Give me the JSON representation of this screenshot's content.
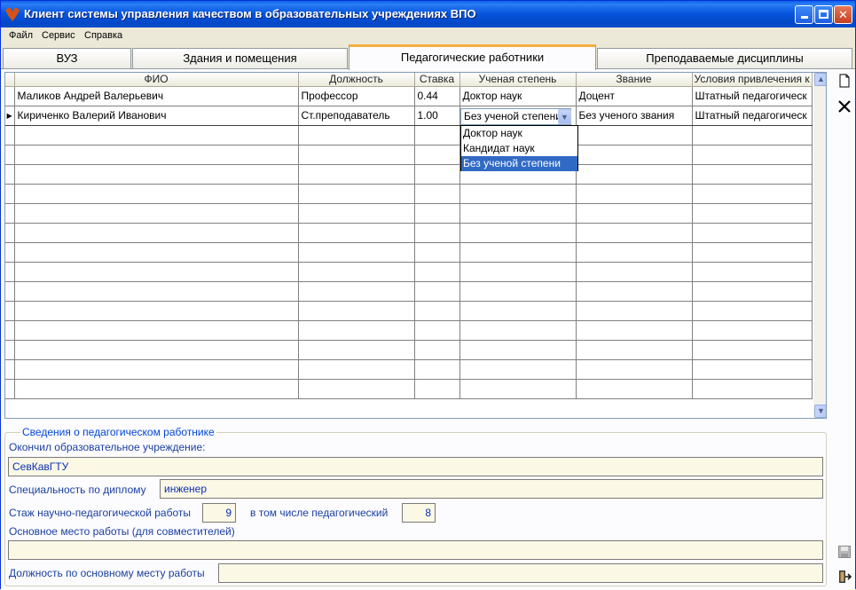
{
  "window": {
    "title": "Клиент системы управления качеством в образовательных учреждениях ВПО"
  },
  "menu": [
    "Файл",
    "Сервис",
    "Справка"
  ],
  "tabs": [
    "ВУЗ",
    "Здания и помещения",
    "Педагогические работники",
    "Преподаваемые дисциплины"
  ],
  "active_tab": "Педагогические работники",
  "grid": {
    "columns": [
      "ФИО",
      "Должность",
      "Ставка",
      "Ученая степень",
      "Звание",
      "Условия привлечения к"
    ],
    "rows": [
      [
        "Маликов Андрей Валерьевич",
        "Профессор",
        "0.44",
        "Доктор наук",
        "Доцент",
        "Штатный педагогическ"
      ],
      [
        "Кириченко Валерий Иванович",
        "Ст.преподаватель",
        "1.00",
        "Без ученой степени",
        "Без ученого звания",
        "Штатный педагогическ"
      ]
    ],
    "current_row": 1,
    "editing_value": "Без ученой степени"
  },
  "dropdown": {
    "options": [
      "Доктор наук",
      "Кандидат наук",
      "Без ученой степени"
    ],
    "selected": "Без ученой степени"
  },
  "details": {
    "group_title": "Сведения о педагогическом работнике",
    "institution_label": "Окончил образовательное учреждение:",
    "institution_value": "СевКавГТУ",
    "specialty_label": "Специальность по диплому",
    "specialty_value": "инженер",
    "experience_label": "Стаж научно-педагогической работы",
    "experience_value": "9",
    "pedagogical_label": "в том числе педагогический",
    "pedagogical_value": "8",
    "main_job_label": "Основное место работы (для совместителей)",
    "main_job_value": "",
    "main_position_label": "Должность по основному месту работы",
    "main_position_value": ""
  },
  "icons": {
    "new": "new-document-icon",
    "delete": "delete-x-icon",
    "save": "save-disk-icon",
    "exit": "exit-door-icon"
  }
}
